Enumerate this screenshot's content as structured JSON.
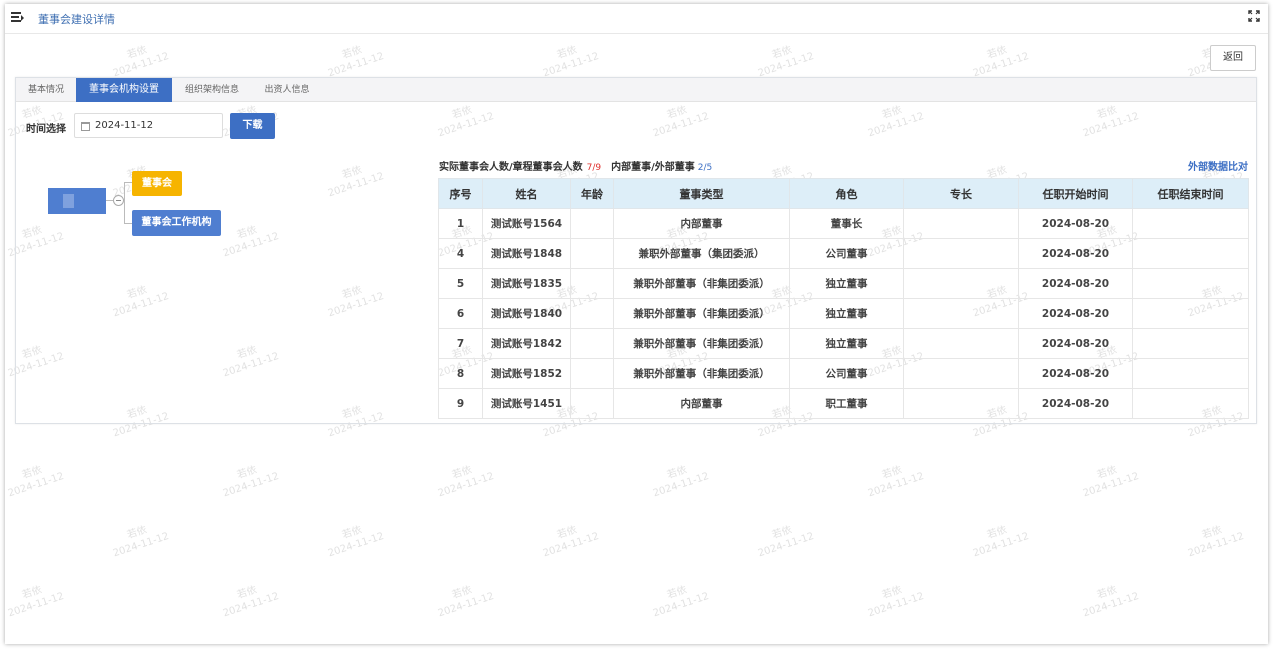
{
  "header": {
    "title": "董事会建设详情",
    "menu_icon": "menu-fold-icon",
    "fullscreen_icon": "fullscreen-icon"
  },
  "back_button": "返回",
  "tabs": [
    {
      "label": "基本情况",
      "active": false
    },
    {
      "label": "董事会机构设置",
      "active": true
    },
    {
      "label": "组织架构信息",
      "active": false
    },
    {
      "label": "出资人信息",
      "active": false
    }
  ],
  "filter": {
    "label": "时间选择",
    "date": "2024-11-12",
    "download_label": "下载"
  },
  "tree": {
    "root_label": "",
    "children": [
      "董事会",
      "董事会工作机构"
    ]
  },
  "stats": {
    "actual_label": "实际董事会人数/章程董事会人数",
    "actual_value": "7/9",
    "internal_label": "内部董事/外部董事",
    "internal_value": "2/5",
    "compare_link": "外部数据比对"
  },
  "table": {
    "columns": [
      "序号",
      "姓名",
      "年龄",
      "董事类型",
      "角色",
      "专长",
      "任职开始时间",
      "任职结束时间"
    ],
    "rows": [
      [
        "1",
        "测试账号1564",
        "",
        "内部董事",
        "董事长",
        "",
        "2024-08-20",
        ""
      ],
      [
        "4",
        "测试账号1848",
        "",
        "兼职外部董事（集团委派）",
        "公司董事",
        "",
        "2024-08-20",
        ""
      ],
      [
        "5",
        "测试账号1835",
        "",
        "兼职外部董事（非集团委派）",
        "独立董事",
        "",
        "2024-08-20",
        ""
      ],
      [
        "6",
        "测试账号1840",
        "",
        "兼职外部董事（非集团委派）",
        "独立董事",
        "",
        "2024-08-20",
        ""
      ],
      [
        "7",
        "测试账号1842",
        "",
        "兼职外部董事（非集团委派）",
        "独立董事",
        "",
        "2024-08-20",
        ""
      ],
      [
        "8",
        "测试账号1852",
        "",
        "兼职外部董事（非集团委派）",
        "公司董事",
        "",
        "2024-08-20",
        ""
      ],
      [
        "9",
        "测试账号1451",
        "",
        "内部董事",
        "职工董事",
        "",
        "2024-08-20",
        ""
      ]
    ]
  },
  "watermark": {
    "name": "若依",
    "date": "2024-11-12"
  },
  "colors": {
    "primary": "#3d6fc4",
    "board_node": "#f6b400",
    "stat_red": "#e0302d",
    "table_header": "#ddeef8"
  }
}
